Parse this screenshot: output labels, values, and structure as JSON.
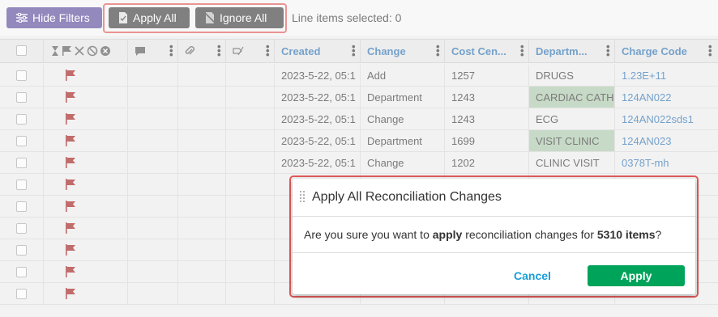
{
  "toolbar": {
    "hide_filters_label": "Hide Filters",
    "apply_all_label": "Apply All",
    "ignore_all_label": "Ignore All",
    "selected_text": "Line items selected: 0"
  },
  "table": {
    "headers": {
      "created": "Created",
      "change": "Change",
      "cost_center": "Cost Cen...",
      "department": "Departm...",
      "charge_code": "Charge Code"
    },
    "rows": [
      {
        "created": "2023-5-22, 05:1",
        "change": "Add",
        "cost_center": "1257",
        "department": "DRUGS",
        "charge_code": "1.23E+11"
      },
      {
        "created": "2023-5-22, 05:1",
        "change": "Department",
        "cost_center": "1243",
        "department": "CARDIAC CATH",
        "charge_code": "124AN022"
      },
      {
        "created": "2023-5-22, 05:1",
        "change": "Change",
        "cost_center": "1243",
        "department": "ECG",
        "charge_code": "124AN022sds1"
      },
      {
        "created": "2023-5-22, 05:1",
        "change": "Department",
        "cost_center": "1699",
        "department": "VISIT CLINIC",
        "charge_code": "124AN023"
      },
      {
        "created": "2023-5-22, 05:1",
        "change": "Change",
        "cost_center": "1202",
        "department": "CLINIC VISIT",
        "charge_code": "0378T-mh"
      }
    ]
  },
  "modal": {
    "title": "Apply All Reconciliation Changes",
    "body_prefix": "Are you sure you want to ",
    "body_action": "apply",
    "body_middle": " reconciliation changes for ",
    "body_count": "5310 items",
    "body_suffix": "?",
    "cancel_label": "Cancel",
    "apply_label": "Apply"
  },
  "colors": {
    "purple_button": "#5a4a9a",
    "dark_button": "#3d3d3d",
    "highlight": "#e05a5a",
    "link": "#2a6fb0",
    "apply_green": "#00a35a",
    "cancel_blue": "#1a9ed8",
    "flag_red": "#a01c1c",
    "department_highlight": "#a9c7a9"
  }
}
